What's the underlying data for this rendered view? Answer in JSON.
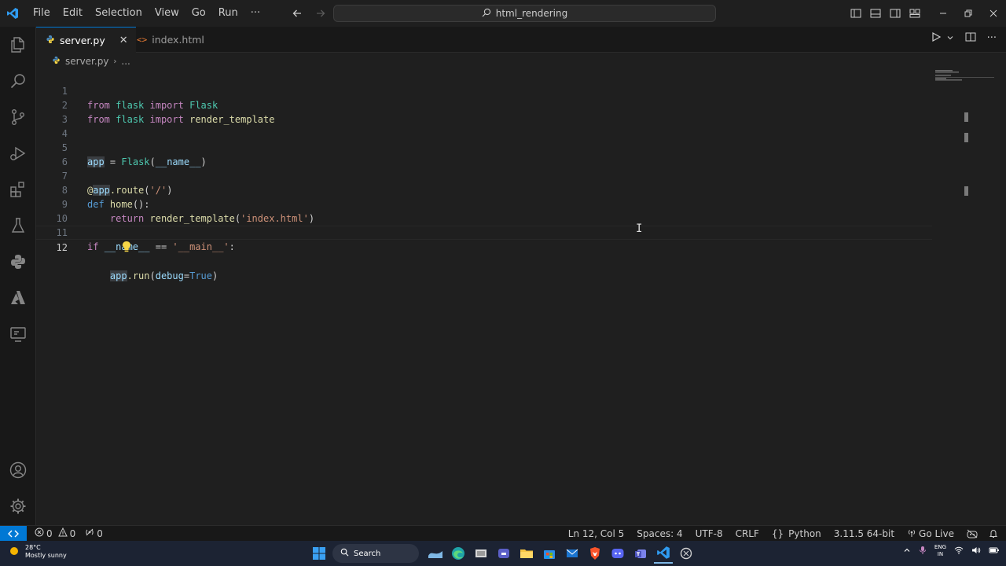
{
  "menu": [
    "File",
    "Edit",
    "Selection",
    "View",
    "Go",
    "Run",
    "···"
  ],
  "command_center": "html_rendering",
  "tabs": [
    {
      "label": "server.py",
      "active": true,
      "icon": "python-icon"
    },
    {
      "label": "index.html",
      "active": false,
      "icon": "html-icon"
    }
  ],
  "breadcrumb": {
    "file": "server.py",
    "more": "..."
  },
  "editor": {
    "line_numbers": [
      "1",
      "2",
      "3",
      "4",
      "5",
      "6",
      "7",
      "8",
      "9",
      "10",
      "11",
      "12"
    ],
    "lines": [
      "from flask import Flask",
      "from flask import render_template",
      "",
      "",
      "app = Flask(__name__)",
      "",
      "@app.route('/')",
      "def home():",
      "    return render_template('index.html')",
      "",
      "if __name__ == '__main__':",
      "    app.run(debug=True)"
    ]
  },
  "status": {
    "errors": "0",
    "warnings": "0",
    "ports": "0",
    "position": "Ln 12, Col 5",
    "spaces": "Spaces: 4",
    "encoding": "UTF-8",
    "eol": "CRLF",
    "language": "Python",
    "interpreter": "3.11.5 64-bit",
    "golive": "Go Live"
  },
  "taskbar": {
    "temperature": "28°C",
    "weather": "Mostly sunny",
    "search": "Search",
    "lang_top": "ENG",
    "lang_bottom": "IN"
  },
  "colors": {
    "accent": "#0078d4",
    "background": "#1f1f1f",
    "keyword": "#c586c0",
    "function": "#dcdcaa",
    "string": "#ce9178",
    "class": "#4ec9b0",
    "variable": "#9cdcfe"
  }
}
